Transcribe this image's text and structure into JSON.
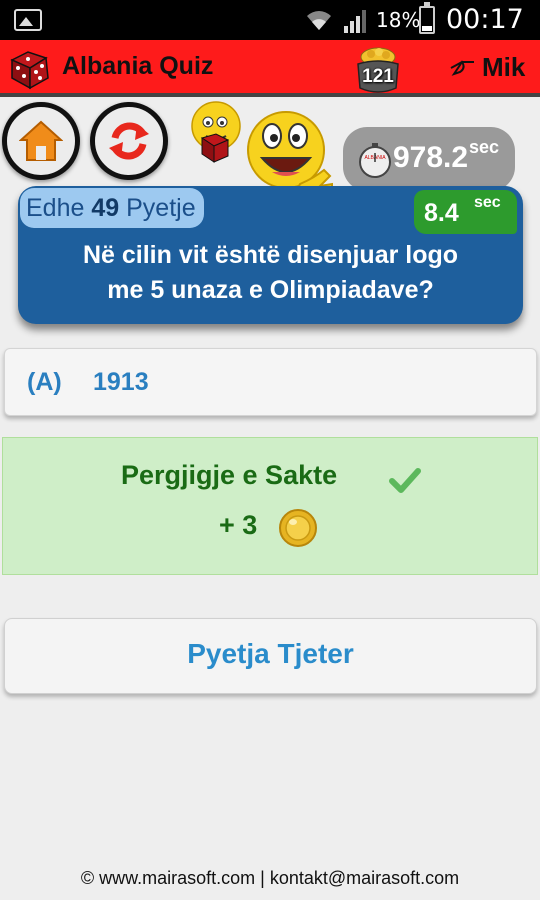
{
  "status_bar": {
    "battery_percent": "18%",
    "time": "00:17",
    "icons": [
      "image-icon",
      "wifi-icon",
      "signal-icon",
      "battery-icon"
    ]
  },
  "header": {
    "app_title": "Albania Quiz",
    "coins": "121",
    "user_name": "Mik",
    "icons": [
      "dice-logo-icon",
      "coin-pot-icon",
      "hand-pointing-icon"
    ]
  },
  "controls": {
    "icons": [
      "home-icon",
      "refresh-icon",
      "smiley-mascot-icon"
    ]
  },
  "total_timer": {
    "value": "978.2",
    "unit": "sec"
  },
  "question": {
    "remaining_prefix": "Edhe",
    "remaining_count": "49",
    "remaining_suffix": "Pyetje",
    "timer_value": "8.4",
    "timer_unit": "sec",
    "text_line1": "Në cilin vit është disenjuar logo",
    "text_line2": "me 5 unaza e Olimpiadave?"
  },
  "answer": {
    "letter": "(A)",
    "text": "1913"
  },
  "result": {
    "message": "Pergjigje e Sakte",
    "points": "+ 3",
    "colors": {
      "background": "#cfeec8",
      "text": "#1a6b15"
    }
  },
  "next_button": {
    "label": "Pyetja Tjeter"
  },
  "footer": {
    "text": "© www.mairasoft.com | kontakt@mairasoft.com"
  },
  "colors": {
    "header": "#fe1b1b",
    "question_card": "#1e5f9d",
    "accent_blue": "#2a7fc0",
    "timer_green": "#2d9b2d"
  }
}
